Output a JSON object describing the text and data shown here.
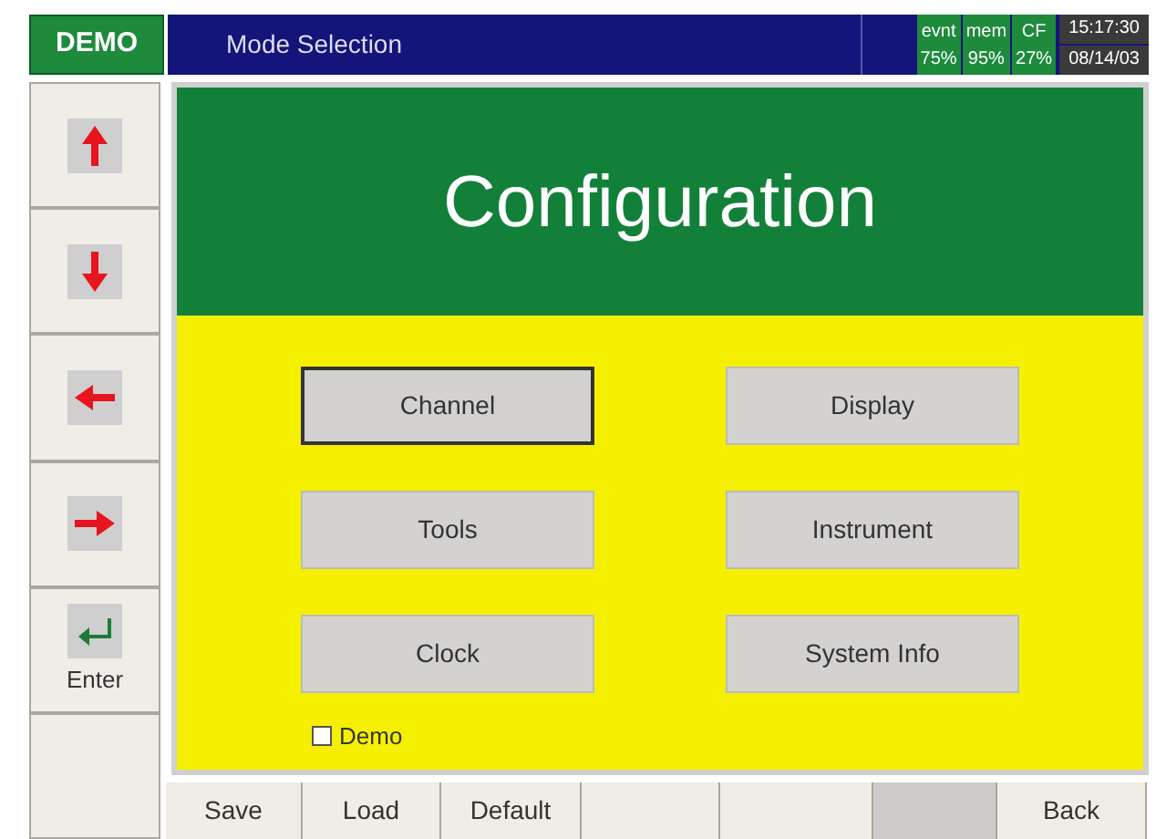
{
  "badge": "DEMO",
  "title": "Mode Selection",
  "status": [
    {
      "label": "evnt",
      "value": "75%"
    },
    {
      "label": "mem",
      "value": "95%"
    },
    {
      "label": "CF",
      "value": "27%"
    }
  ],
  "clock": {
    "time": "15:17:30",
    "date": "08/14/03"
  },
  "nav": [
    {
      "kind": "up"
    },
    {
      "kind": "down"
    },
    {
      "kind": "left"
    },
    {
      "kind": "right"
    },
    {
      "kind": "enter",
      "label": "Enter"
    },
    {
      "kind": "empty"
    }
  ],
  "heading": "Configuration",
  "buttons": [
    {
      "label": "Channel",
      "focused": true
    },
    {
      "label": "Display",
      "focused": false
    },
    {
      "label": "Tools",
      "focused": false
    },
    {
      "label": "Instrument",
      "focused": false
    },
    {
      "label": "Clock",
      "focused": false
    },
    {
      "label": "System Info",
      "focused": false
    }
  ],
  "demo": {
    "label": "Demo",
    "checked": false
  },
  "footer": [
    {
      "kind": "label",
      "label": "Save"
    },
    {
      "kind": "label",
      "label": "Load"
    },
    {
      "kind": "label",
      "label": "Default"
    },
    {
      "kind": "empty"
    },
    {
      "kind": "empty"
    },
    {
      "kind": "shaded"
    },
    {
      "kind": "label",
      "label": "Back"
    }
  ]
}
